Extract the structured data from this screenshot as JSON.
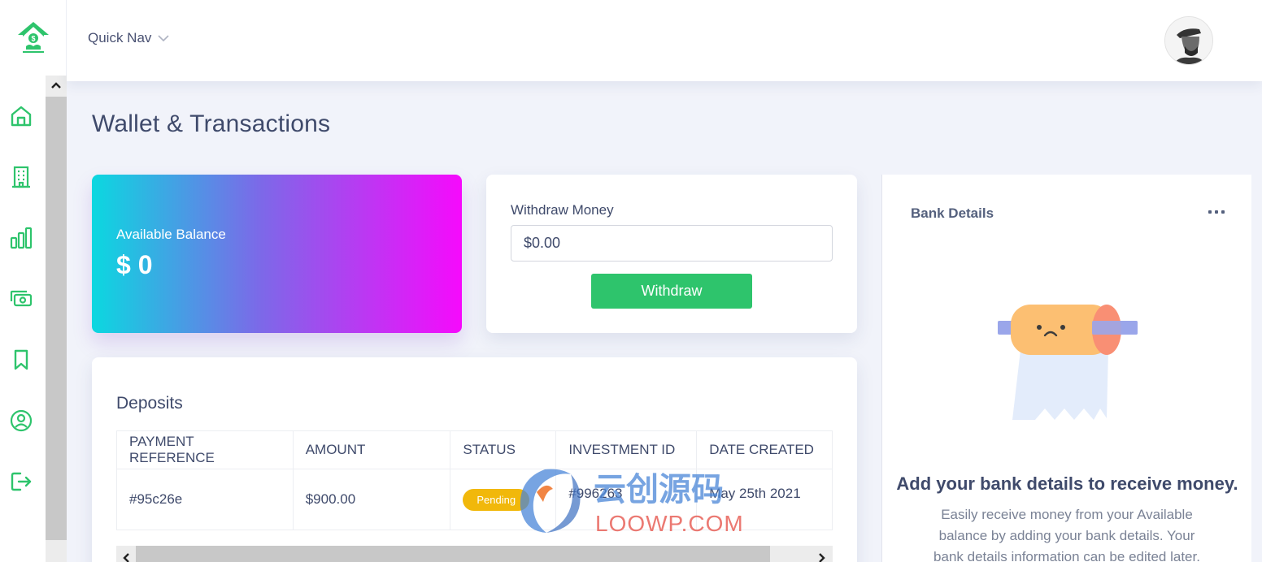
{
  "header": {
    "quick_nav": "Quick Nav"
  },
  "page": {
    "title": "Wallet & Transactions"
  },
  "balance": {
    "label": "Available Balance",
    "value": "$ 0"
  },
  "withdraw": {
    "label": "Withdraw Money",
    "input_value": "$0.00",
    "button": "Withdraw"
  },
  "deposits": {
    "title": "Deposits",
    "columns": [
      "PAYMENT REFERENCE",
      "AMOUNT",
      "STATUS",
      "INVESTMENT ID",
      "DATE CREATED"
    ],
    "rows": [
      {
        "reference": "#95c26e",
        "amount": "$900.00",
        "status": "Pending",
        "investment_id": "#996263",
        "date": "May 25th 2021"
      }
    ]
  },
  "bank": {
    "title": "Bank Details",
    "heading": "Add your bank details to receive money.",
    "text": "Easily receive money from your Available balance by adding your bank details. Your bank details information can be edited later."
  },
  "watermark": {
    "main": "云创源码",
    "sub": "LOOWP.COM"
  },
  "icons": {
    "logo": "house-money-logo-icon",
    "nav": [
      "home-icon",
      "building-icon",
      "chart-icon",
      "money-icon",
      "bookmark-icon",
      "user-icon",
      "logout-icon"
    ]
  },
  "colors": {
    "accent": "#2ec46c",
    "pending": "#f1b80b",
    "gradient_start": "#0bd8e0",
    "gradient_end": "#f60afc"
  }
}
